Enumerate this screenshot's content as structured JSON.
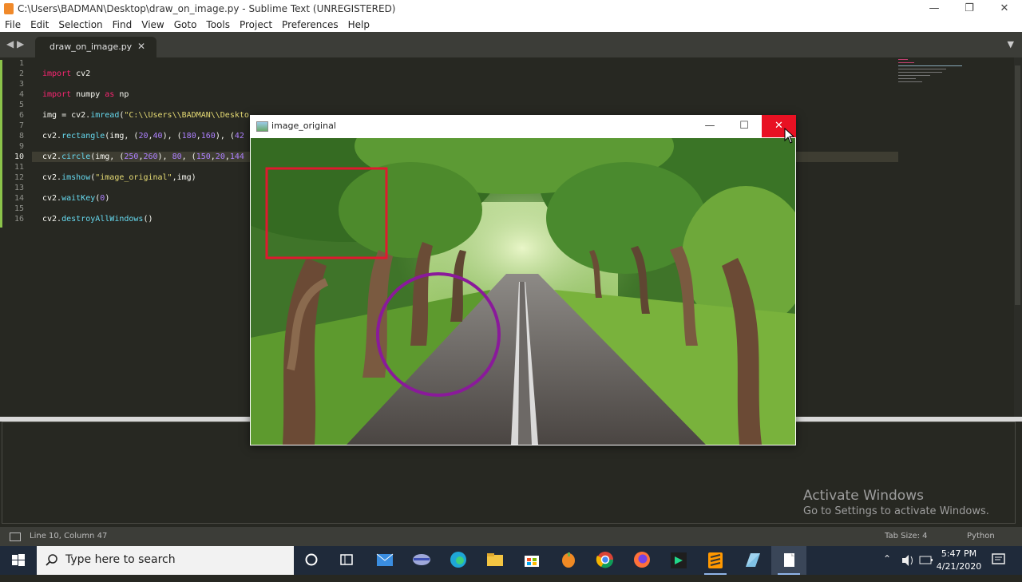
{
  "window": {
    "title": "C:\\Users\\BADMAN\\Desktop\\draw_on_image.py - Sublime Text (UNREGISTERED)",
    "controls": {
      "minimize": "—",
      "restore": "❐",
      "close": "✕"
    }
  },
  "menu": [
    "File",
    "Edit",
    "Selection",
    "Find",
    "View",
    "Goto",
    "Tools",
    "Project",
    "Preferences",
    "Help"
  ],
  "tabs": {
    "nav": "◀ ▶",
    "active": "draw_on_image.py",
    "close": "✕",
    "dropdown": "▼"
  },
  "editor": {
    "line_numbers": [
      "1",
      "2",
      "3",
      "4",
      "5",
      "6",
      "7",
      "8",
      "9",
      "10",
      "11",
      "12",
      "13",
      "14",
      "15",
      "16"
    ],
    "current_line": "10",
    "code": {
      "l2_kw": "import",
      "l2_rest": " cv2",
      "l4_kw": "import",
      "l4_mod": " numpy ",
      "l4_as": "as",
      "l4_alias": " np",
      "l6_a": "img = cv2.",
      "l6_fn": "imread",
      "l6_b": "(",
      "l6_str": "\"C:\\\\Users\\\\BADMAN\\\\Deskto",
      "l8_a": "cv2.",
      "l8_fn": "rectangle",
      "l8_b": "(img, (",
      "l8_n1": "20",
      "l8_c": ",",
      "l8_n2": "40",
      "l8_d": "), (",
      "l8_n3": "180",
      "l8_e": ",",
      "l8_n4": "160",
      "l8_f": "), (",
      "l8_n5": "42",
      "l10_a": "cv2.",
      "l10_fn": "circle",
      "l10_b": "(img, (",
      "l10_n1": "250",
      "l10_c": ",",
      "l10_n2": "260",
      "l10_d": "), ",
      "l10_n3": "80",
      "l10_e": ", (",
      "l10_n4": "150",
      "l10_f": ",",
      "l10_n5": "20",
      "l10_g": ",",
      "l10_n6": "144",
      "l12_a": "cv2.",
      "l12_fn": "imshow",
      "l12_b": "(",
      "l12_str": "\"image_original\"",
      "l12_c": ",img)",
      "l14_a": "cv2.",
      "l14_fn": "waitKey",
      "l14_b": "(",
      "l14_n": "0",
      "l14_c": ")",
      "l16_a": "cv2.",
      "l16_fn": "destroyAllWindows",
      "l16_b": "()"
    }
  },
  "cv_window": {
    "title": "image_original",
    "min": "—",
    "max": "☐",
    "close": "✕"
  },
  "status": {
    "position": "Line 10, Column 47",
    "tab_size": "Tab Size: 4",
    "syntax": "Python"
  },
  "watermark": {
    "line1": "Activate Windows",
    "line2": "Go to Settings to activate Windows."
  },
  "taskbar": {
    "search_placeholder": "Type here to search",
    "time": "5:47 PM",
    "date": "4/21/2020",
    "tray_caret": "⌃"
  },
  "colors": {
    "accent_close": "#e81123",
    "editor_bg": "#272822",
    "rect_color": "#e0192f",
    "circle_color": "#8a1a9a"
  }
}
